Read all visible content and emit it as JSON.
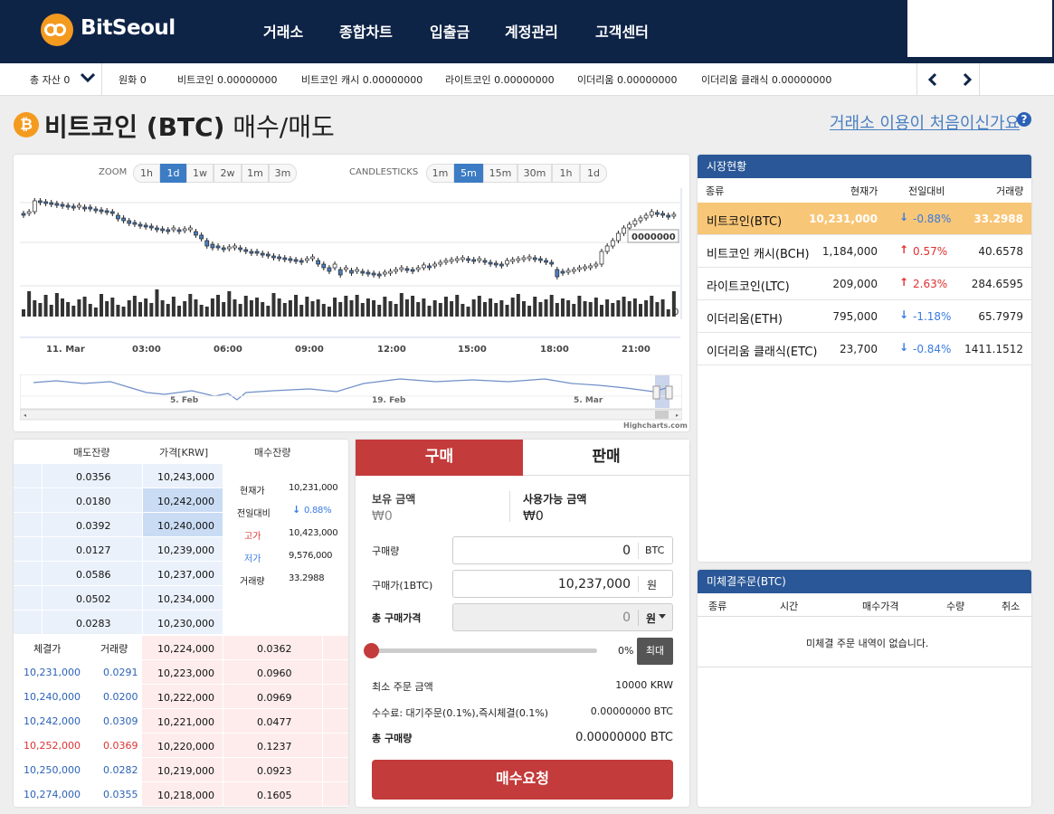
{
  "header": {
    "brand": "BitSeoul",
    "nav": [
      "거래소",
      "종합차트",
      "입출금",
      "계정관리",
      "고객센터"
    ]
  },
  "ticker": {
    "total_label": "총 자산 0",
    "items": [
      "원화 0",
      "비트코인 0.00000000",
      "비트코인 캐시 0.00000000",
      "라이트코인 0.00000000",
      "이더리움 0.00000000",
      "이더리움 클래식 0.00000000"
    ]
  },
  "title": {
    "coin": "비트코인 (BTC)",
    "action": "매수/매도",
    "help": "거래소 이용이 처음이신가요"
  },
  "chart": {
    "zoom_label": "ZOOM",
    "zoom": [
      "1h",
      "1d",
      "1w",
      "2w",
      "1m",
      "3m"
    ],
    "zoom_active": 1,
    "candle_label": "CANDLESTICKS",
    "candles": [
      "1m",
      "5m",
      "15m",
      "30m",
      "1h",
      "1d"
    ],
    "candle_active": 1,
    "time_labels": [
      "11. Mar",
      "03:00",
      "06:00",
      "09:00",
      "12:00",
      "15:00",
      "18:00",
      "21:00"
    ],
    "price_flag": "0000000",
    "vol_zero": "0",
    "nav_labels": [
      "5. Feb",
      "19. Feb",
      "5. Mar"
    ],
    "credit": "Highcharts.com"
  },
  "market": {
    "title": "시장현황",
    "cols": [
      "종류",
      "현재가",
      "전일대비",
      "거래량"
    ],
    "rows": [
      {
        "name": "비트코인(BTC)",
        "price": "10,231,000",
        "change": "-0.88%",
        "dir": "down",
        "vol": "33.2988"
      },
      {
        "name": "비트코인 캐시(BCH)",
        "price": "1,184,000",
        "change": "0.57%",
        "dir": "up",
        "vol": "40.6578"
      },
      {
        "name": "라이트코인(LTC)",
        "price": "209,000",
        "change": "2.63%",
        "dir": "up",
        "vol": "284.6595"
      },
      {
        "name": "이더리움(ETH)",
        "price": "795,000",
        "change": "-1.18%",
        "dir": "down",
        "vol": "65.7979"
      },
      {
        "name": "이더리움 클래식(ETC)",
        "price": "23,700",
        "change": "-0.84%",
        "dir": "down",
        "vol": "1411.1512"
      }
    ]
  },
  "orderbook": {
    "cols": [
      "매도잔량",
      "가격[KRW]",
      "매수잔량"
    ],
    "asks": [
      {
        "qty": "0.0356",
        "price": "10,243,000"
      },
      {
        "qty": "0.0180",
        "price": "10,242,000"
      },
      {
        "qty": "0.0392",
        "price": "10,240,000"
      },
      {
        "qty": "0.0127",
        "price": "10,239,000"
      },
      {
        "qty": "0.0586",
        "price": "10,237,000"
      },
      {
        "qty": "0.0502",
        "price": "10,234,000"
      },
      {
        "qty": "0.0283",
        "price": "10,230,000"
      }
    ],
    "bids": [
      {
        "price": "10,224,000",
        "qty": "0.0362"
      },
      {
        "price": "10,223,000",
        "qty": "0.0960"
      },
      {
        "price": "10,222,000",
        "qty": "0.0969"
      },
      {
        "price": "10,221,000",
        "qty": "0.0477"
      },
      {
        "price": "10,220,000",
        "qty": "0.1237"
      },
      {
        "price": "10,219,000",
        "qty": "0.0923"
      },
      {
        "price": "10,218,000",
        "qty": "0.1605"
      }
    ],
    "ask_fill": [
      0,
      0.6,
      0.45,
      0,
      0,
      0,
      0
    ],
    "stats": [
      {
        "k": "현재가",
        "v": "10,231,000"
      },
      {
        "k": "전일대비",
        "v": "0.88%"
      },
      {
        "k": "고가",
        "v": "10,423,000"
      },
      {
        "k": "저가",
        "v": "9,576,000"
      },
      {
        "k": "거래량",
        "v": "33.2988"
      }
    ],
    "trade_cols": [
      "체결가",
      "거래량"
    ],
    "trades": [
      {
        "p": "10,231,000",
        "q": "0.0291",
        "c": "blue"
      },
      {
        "p": "10,240,000",
        "q": "0.0200",
        "c": "blue"
      },
      {
        "p": "10,242,000",
        "q": "0.0309",
        "c": "blue"
      },
      {
        "p": "10,252,000",
        "q": "0.0369",
        "c": "red"
      },
      {
        "p": "10,250,000",
        "q": "0.0282",
        "c": "blue"
      },
      {
        "p": "10,274,000",
        "q": "0.0355",
        "c": "blue"
      }
    ]
  },
  "order": {
    "tab_buy": "구매",
    "tab_sell": "판매",
    "hold_label": "보유 금액",
    "hold_val": "₩0",
    "avail_label": "사용가능 금액",
    "avail_val": "₩0",
    "qty_label": "구매량",
    "qty_val": "0",
    "qty_unit": "BTC",
    "price_label": "구매가(1BTC)",
    "price_val": "10,237,000",
    "price_unit": "원",
    "total_label": "총 구매가격",
    "total_val": "0",
    "total_unit": "원",
    "slider_pct": "0%",
    "slider_value": 0,
    "max_btn": "최대",
    "min_label": "최소 주문 금액",
    "min_val": "10000 KRW",
    "fee_label": "수수료: 대기주문(0.1%),즉시체결(0.1%)",
    "fee_val": "0.00000000 BTC",
    "sum_label": "총 구매량",
    "sum_val": "0.00000000 BTC",
    "submit": "매수요청"
  },
  "unfilled": {
    "title": "미체결주문(BTC)",
    "cols": [
      "종류",
      "시간",
      "매수가격",
      "수량",
      "취소"
    ],
    "empty": "미체결 주문 내역이 없습니다."
  },
  "colors": {
    "navy": "#0e2447",
    "orange": "#f49a1f",
    "red": "#c43b3b",
    "blue": "#2a5797",
    "highlight": "#f8c677"
  }
}
